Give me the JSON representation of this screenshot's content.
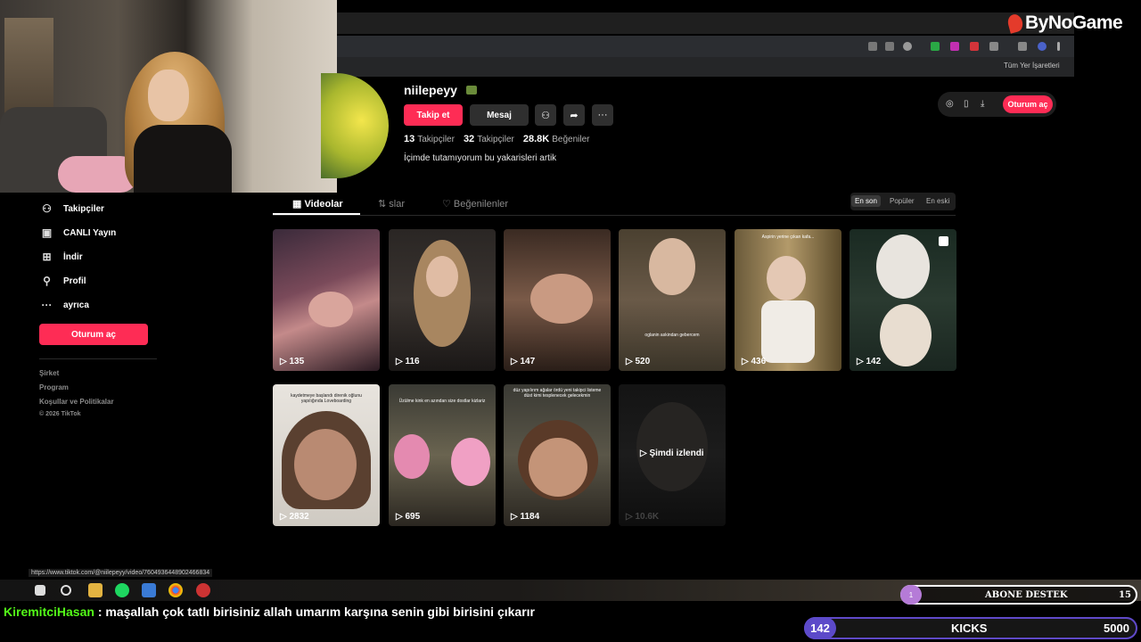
{
  "brand": {
    "name": "ByNoGame"
  },
  "browser": {
    "bookmarks_label": "Tüm Yer İşaretleri"
  },
  "profile": {
    "username": "niilepeyy",
    "follow_label": "Takip et",
    "message_label": "Mesaj",
    "stats": [
      {
        "value": "13",
        "label": "Takipçiler"
      },
      {
        "value": "32",
        "label": "Takipçiler"
      },
      {
        "value": "28.8K",
        "label": "Beğeniler"
      }
    ],
    "bio": "İçimde tutamıyorum bu yakarisleri artik"
  },
  "top_right": {
    "login_label": "Oturum aç"
  },
  "tabs": [
    {
      "label": "Videolar"
    },
    {
      "label": "slar"
    },
    {
      "label": "Beğenilenler"
    }
  ],
  "sort": {
    "options": [
      "En son",
      "Popüler",
      "En eski"
    ],
    "selected": "En son"
  },
  "sidebar": {
    "items": [
      {
        "label": "Takipçiler",
        "icon": "add-user-icon"
      },
      {
        "label": "CANLI Yayın",
        "icon": "live-icon"
      },
      {
        "label": "İndir",
        "icon": "download-icon"
      },
      {
        "label": "Profil",
        "icon": "person-icon"
      },
      {
        "label": "ayrıca",
        "icon": "more-icon"
      }
    ],
    "login_label": "Oturum aç",
    "footer": [
      "Şirket",
      "Program",
      "Koşullar ve Politikalar",
      "© 2026 TikTok"
    ]
  },
  "videos": [
    {
      "views": "135"
    },
    {
      "views": "116"
    },
    {
      "views": "147"
    },
    {
      "views": "520",
      "caption": "oglanin askindan gebercem"
    },
    {
      "views": "436",
      "caption": "Aspirin yerine çıkan kafa..."
    },
    {
      "views": "142"
    },
    {
      "views": "2832",
      "caption": "kaydetmeye başlandı direnik oğlunu yapılığında Loveboarding"
    },
    {
      "views": "695",
      "caption": "Üzülme kink en azından size dostlar kizlariz"
    },
    {
      "views": "1184",
      "caption": "düz yapılırım ağalar ördü yeni takipci listeme düst kimi tesplenecek gelecekmin"
    },
    {
      "views": "10.6K",
      "watched_label": "Şimdi izlendi"
    }
  ],
  "status_url": "https://www.tiktok.com/@niilepeyy/video/7604936448902466834",
  "chat": {
    "user": "KiremitciHasan",
    "message": ": maşallah çok tatlı birisiniz allah umarım karşına senin gibi birisini çıkarır"
  },
  "overlays": {
    "abone": {
      "left_value": "1",
      "label": "ABONE DESTEK",
      "value": "15"
    },
    "kicks": {
      "left_value": "142",
      "label": "KICKS",
      "value": "5000"
    }
  }
}
